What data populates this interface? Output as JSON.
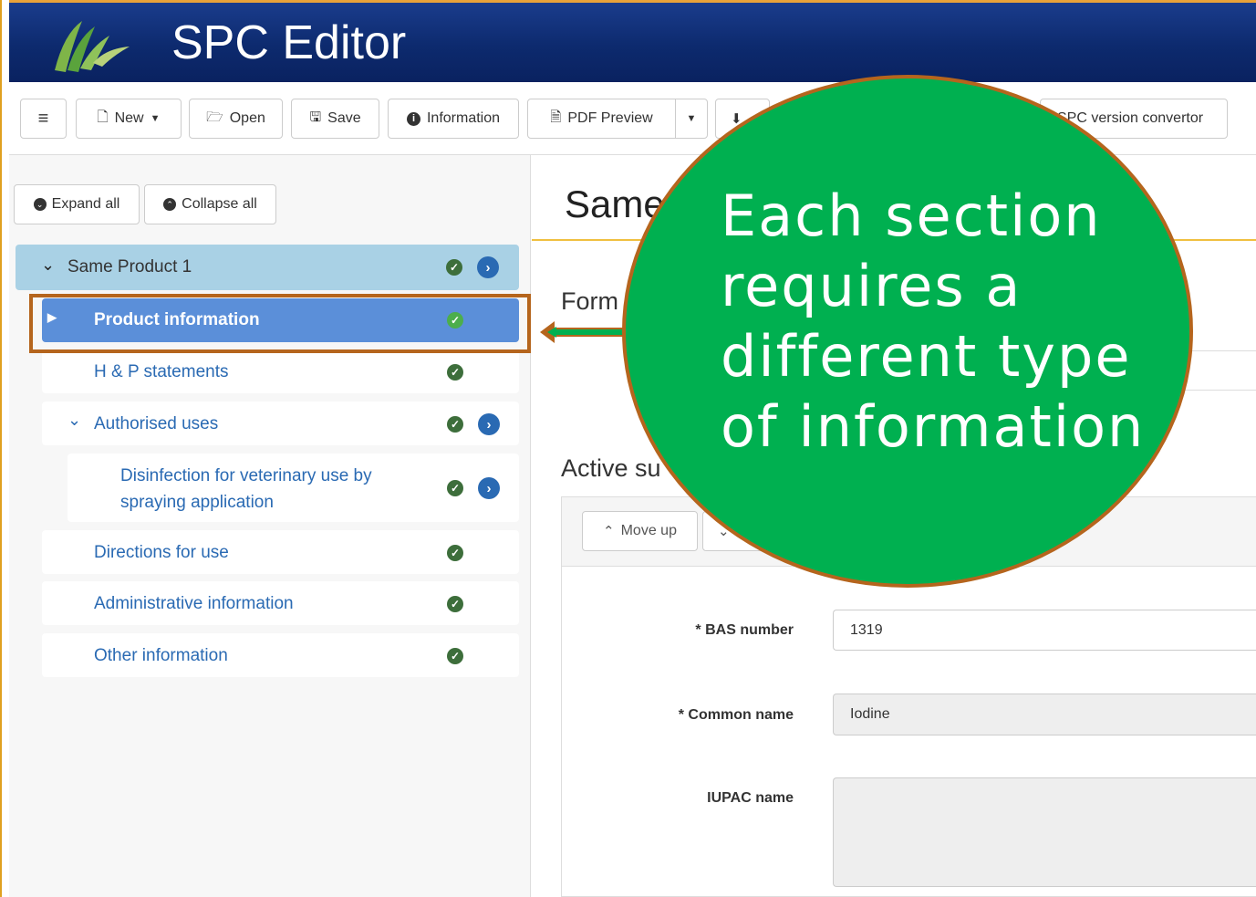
{
  "app": {
    "title": "SPC Editor"
  },
  "toolbar": {
    "new_label": "New",
    "open_label": "Open",
    "save_label": "Save",
    "information_label": "Information",
    "pdf_preview_label": "PDF Preview",
    "converter_label": "SPC version convertor"
  },
  "sidebar": {
    "expand_all": "Expand all",
    "collapse_all": "Collapse all",
    "tree": [
      {
        "label": "Same Product 1"
      },
      {
        "label": "Product information"
      },
      {
        "label": "H & P statements"
      },
      {
        "label": "Authorised uses"
      },
      {
        "label": "Disinfection for veterinary use by spraying application"
      },
      {
        "label": "Directions for use"
      },
      {
        "label": "Administrative information"
      },
      {
        "label": "Other information"
      }
    ]
  },
  "main": {
    "title": "Same",
    "section_1": "Form",
    "section_2": "Active su",
    "move_up_label": "Move up",
    "fields": [
      {
        "label": "* BAS number",
        "value": "1319"
      },
      {
        "label": "* Common name",
        "value": "Iodine"
      },
      {
        "label": "IUPAC name",
        "value": ""
      }
    ]
  },
  "callout": {
    "text": "Each section requires a different type of information"
  },
  "colors": {
    "header_blue": "#0d2a6e",
    "selected_blue": "#5b8fd9",
    "callout_green": "#00b050",
    "callout_border": "#b5651d",
    "link_blue": "#2a6ab3",
    "check_green": "#3d6e3b"
  },
  "icons": [
    "menu-icon",
    "file-icon",
    "folder-open-icon",
    "save-icon",
    "info-icon",
    "pdf-icon",
    "caret-down-icon",
    "download-icon",
    "chevron-circle-down-icon",
    "chevron-circle-up-icon",
    "chevron-down-icon",
    "caret-right-icon",
    "check-circle-icon",
    "arrow-circle-right-icon",
    "chevron-up-icon",
    "arrow-left-icon"
  ]
}
